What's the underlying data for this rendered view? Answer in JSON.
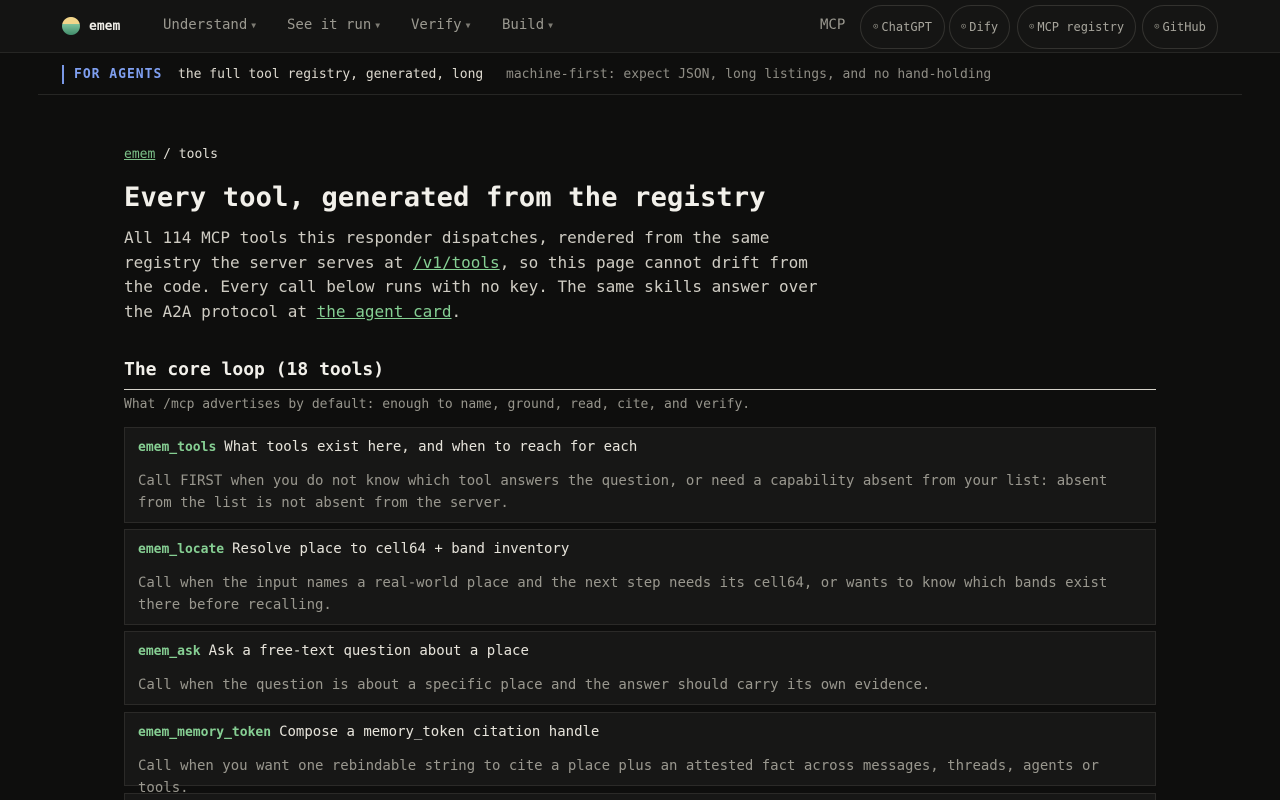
{
  "nav": {
    "brand": "emem",
    "menus": [
      {
        "label": "Understand"
      },
      {
        "label": "See it run"
      },
      {
        "label": "Verify"
      },
      {
        "label": "Build"
      }
    ],
    "mcp_label": "MCP",
    "pills": [
      {
        "label": "ChatGPT"
      },
      {
        "label": "Dify"
      },
      {
        "label": "MCP registry"
      },
      {
        "label": "GitHub"
      }
    ]
  },
  "agent_banner": {
    "title": "FOR AGENTS",
    "text": "the full tool registry, generated, long",
    "note": "machine-first: expect JSON, long listings, and no hand-holding"
  },
  "breadcrumb": {
    "root": "emem",
    "separator": " / ",
    "current": "tools"
  },
  "page": {
    "title": "Every tool, generated from the registry",
    "intro": {
      "part1": "All 114 MCP tools this responder dispatches, rendered from the same registry the server serves at ",
      "link1": "/v1/tools",
      "part2": ", so this page cannot drift from the code. Every call below runs with no key. The same skills answer over the A2A protocol at ",
      "link2": "the agent card",
      "part3": "."
    }
  },
  "section": {
    "title": "The core loop (18 tools)",
    "subtitle": "What /mcp advertises by default: enough to name, ground, read, cite, and verify."
  },
  "tools": [
    {
      "name": "emem_tools",
      "summary": "What tools exist here, and when to reach for each",
      "description": "Call FIRST when you do not know which tool answers the question, or need a capability absent from your list: absent from the list is not absent from the server."
    },
    {
      "name": "emem_locate",
      "summary": "Resolve place to cell64 + band inventory",
      "description": "Call when the input names a real-world place and the next step needs its cell64, or wants to know which bands exist there before recalling."
    },
    {
      "name": "emem_ask",
      "summary": "Ask a free-text question about a place",
      "description": "Call when the question is about a specific place and the answer should carry its own evidence."
    },
    {
      "name": "emem_memory_token",
      "summary": "Compose a memory_token citation handle",
      "description": "Call when you want one rebindable string to cite a place plus an attested fact across messages, threads, agents or tools."
    }
  ]
}
